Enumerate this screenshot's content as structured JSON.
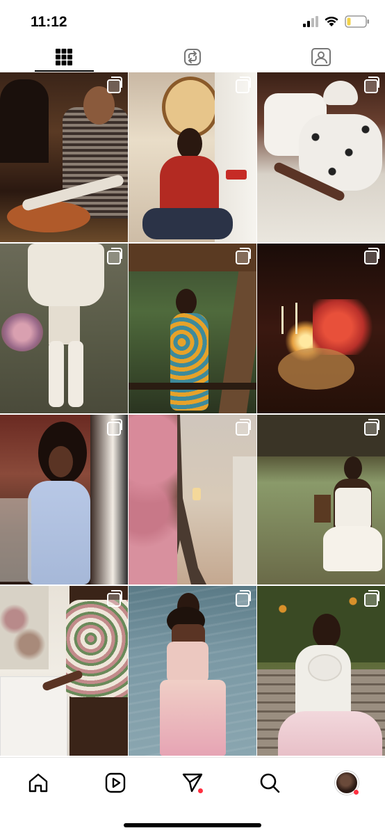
{
  "status_bar": {
    "time": "11:12",
    "icons": [
      "cellular-signal-icon",
      "wifi-icon",
      "battery-low-icon"
    ],
    "battery_color": "#f2d24a"
  },
  "tabs": [
    {
      "name": "grid-tab",
      "icon": "grid-icon",
      "active": true
    },
    {
      "name": "reposts-tab",
      "icon": "repost-icon",
      "active": false
    },
    {
      "name": "tagged-tab",
      "icon": "tagged-person-icon",
      "active": false
    }
  ],
  "posts": [
    {
      "icon": "carousel-icon",
      "desc": "restaurant"
    },
    {
      "icon": "carousel-icon",
      "desc": "red-sweater"
    },
    {
      "icon": "carousel-icon",
      "desc": "dalmatian-coat"
    },
    {
      "icon": "carousel-icon",
      "desc": "knit-sweater-basket"
    },
    {
      "icon": "carousel-icon",
      "desc": "floral-dress-palms"
    },
    {
      "icon": "carousel-icon",
      "desc": "candle-lily"
    },
    {
      "icon": "carousel-icon",
      "desc": "blue-dress"
    },
    {
      "icon": "carousel-icon",
      "desc": "eiffel-tower"
    },
    {
      "icon": "carousel-icon",
      "desc": "white-dress-field"
    },
    {
      "icon": "carousel-icon",
      "desc": "floral-skirt"
    },
    {
      "icon": "carousel-icon",
      "desc": "pink-dress-water"
    },
    {
      "icon": "carousel-icon",
      "desc": "white-dress-bench"
    }
  ],
  "bottom_nav": [
    {
      "name": "home",
      "icon": "home-icon"
    },
    {
      "name": "reels",
      "icon": "reels-icon"
    },
    {
      "name": "messages",
      "icon": "send-icon",
      "badge": true
    },
    {
      "name": "search",
      "icon": "search-icon"
    },
    {
      "name": "profile",
      "icon": "profile-avatar",
      "badge": true
    }
  ],
  "colors": {
    "badge": "#ff3040",
    "active_underline": "#000000"
  }
}
